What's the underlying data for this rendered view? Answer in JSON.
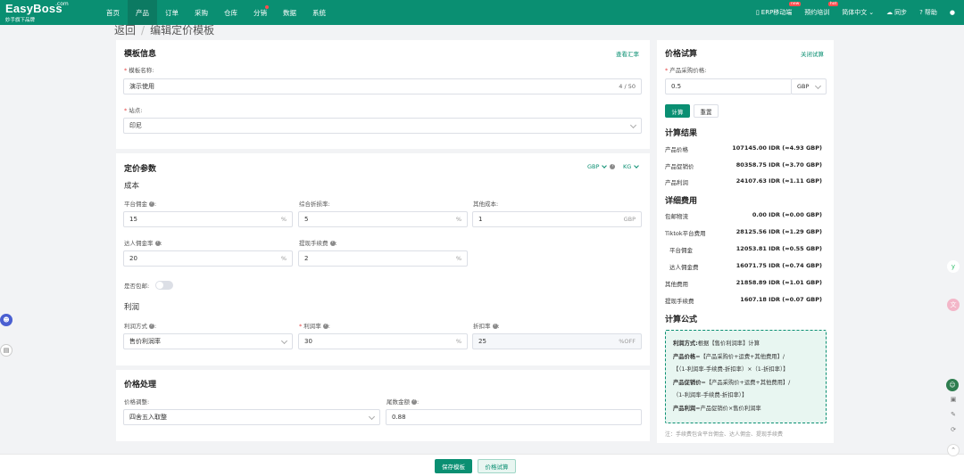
{
  "brand": {
    "name": "EasyBoss",
    "com": ".com",
    "slogan": "妙手旗下品牌"
  },
  "nav": [
    "首页",
    "产品",
    "订单",
    "采购",
    "仓库",
    "分销",
    "数据",
    "系统"
  ],
  "nav_active": "产品",
  "right_nav": {
    "erp": "ERP移动端",
    "erp_tag": "new",
    "training": "预约培训",
    "training_tag": "hot",
    "lang": "简体中文",
    "sync": "同步",
    "help": "帮助"
  },
  "breadcrumb": {
    "back": "返回",
    "sep": "/",
    "title": "编辑定价模板"
  },
  "template_info": {
    "title": "模板信息",
    "rates_link": "查看汇率",
    "name_label": "模板名称:",
    "name_value": "演示使用",
    "name_count": "4 / 50",
    "site_label": "站点:",
    "site_value": "印尼"
  },
  "pricing_params": {
    "title": "定价参数",
    "currency": "GBP",
    "weight_unit": "KG",
    "cost_title": "成本",
    "platform_fee_label": "平台佣金",
    "platform_fee_value": "15",
    "platform_fee_unit": "%",
    "discount_label": "综合折损率:",
    "discount_value": "5",
    "discount_unit": "%",
    "other_cost_label": "其他成本:",
    "other_cost_value": "1",
    "other_cost_unit": "GBP",
    "influencer_label": "达人佣金率",
    "influencer_value": "20",
    "influencer_unit": "%",
    "withdraw_label": "提现手续费",
    "withdraw_value": "2",
    "withdraw_unit": "%",
    "free_shipping_label": "是否包邮:",
    "free_shipping_on": false,
    "profit_title": "利润",
    "profit_method_label": "利润方式",
    "profit_method_value": "售价利润率",
    "profit_rate_label": "利润率",
    "profit_rate_value": "30",
    "profit_rate_unit": "%",
    "discount_rate_label": "折扣率",
    "discount_rate_value": "25",
    "discount_rate_unit": "%OFF"
  },
  "price_processing": {
    "title": "价格处理",
    "adjust_label": "价格调整:",
    "adjust_value": "四舍五入取整",
    "tail_label": "尾数金额",
    "tail_value": "0.88"
  },
  "calculator": {
    "title": "价格试算",
    "close_link": "关闭试算",
    "purchase_label": "产品采购价格:",
    "purchase_value": "0.5",
    "purchase_currency": "GBP",
    "calc_btn": "计算",
    "reset_btn": "重置",
    "result_title": "计算结果",
    "results": [
      {
        "label": "产品价格",
        "value": "107145.00 IDR (≈4.93 GBP)"
      },
      {
        "label": "产品促销价",
        "value": "80358.75 IDR (≈3.70 GBP)"
      },
      {
        "label": "产品利润",
        "value": "24107.63 IDR (≈1.11 GBP)"
      }
    ],
    "detail_title": "详细费用",
    "details": [
      {
        "label": "包邮物流",
        "value": "0.00 IDR (≈0.00 GBP)",
        "indent": false
      },
      {
        "label": "Tiktok平台费用",
        "value": "28125.56 IDR (≈1.29 GBP)",
        "indent": false
      },
      {
        "label": "平台佣金",
        "value": "12053.81 IDR (≈0.55 GBP)",
        "indent": true
      },
      {
        "label": "达人佣金费",
        "value": "16071.75 IDR (≈0.74 GBP)",
        "indent": true
      },
      {
        "label": "其他费用",
        "value": "21858.89 IDR (≈1.01 GBP)",
        "indent": false
      },
      {
        "label": "提现手续费",
        "value": "1607.18 IDR (≈0.07 GBP)",
        "indent": false
      }
    ],
    "formula_title": "计算公式",
    "formula": {
      "line1_b": "利润方式:",
      "line1": "根据【售价利润率】计算",
      "line2_b": "产品价格",
      "line2": "=【产品采购价+运费+其他费用】/",
      "line3": "【（1-利润率-手续费-折扣率）×（1-折扣率）】",
      "line4_b": "产品促销价",
      "line4": "=【产品采购价+运费+其他费用】/",
      "line5": "（1-利润率-手续费-折扣率）】",
      "line6_b": "产品利润",
      "line6": "=产品促销价×售价利润率"
    },
    "note": "注：手续费包含平台佣金、达人佣金、提现手续费"
  },
  "footer": {
    "save_btn": "保存模板",
    "calc_btn": "价格试算"
  },
  "colors": {
    "primary": "#0a8f72",
    "bg": "#f2f3f5"
  }
}
